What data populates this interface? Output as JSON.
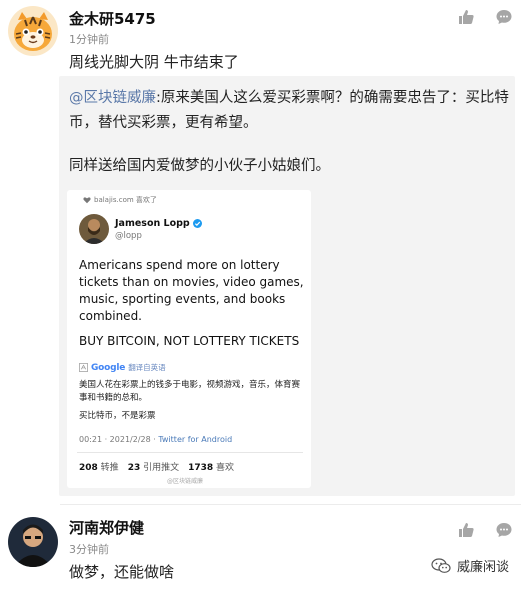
{
  "comments": [
    {
      "username": "金木研5475",
      "time": "1分钟前",
      "text": "周线光脚大阴 牛市结束了",
      "quote": {
        "mention": "@区块链威廉",
        "text": ":原来美国人这么爱买彩票啊？的确需要忠告了：买比特币，替代买彩票，更有希望。",
        "text2": "同样送给国内爱做梦的小伙子小姑娘们。",
        "tweet": {
          "source": "balajis.com 喜欢了",
          "name": "Jameson Lopp",
          "handle": "@lopp",
          "body": "Americans spend more on lottery tickets than on movies, video games, music, sporting events, and books combined.",
          "caps": "BUY BITCOIN, NOT LOTTERY TICKETS",
          "google_label": "Google",
          "translate_label": "翻译自英语",
          "translation1": "美国人花在彩票上的钱多于电影，视频游戏，音乐，体育赛事和书籍的总和。",
          "translation2": "买比特币，不是彩票",
          "time": "00:21 · 2021/2/28 · ",
          "app": "Twitter for Android",
          "retweets": "208",
          "retweets_label": "转推",
          "quotes": "23",
          "quotes_label": "引用推文",
          "likes": "1738",
          "likes_label": "喜欢",
          "watermark": "@区块链威廉"
        }
      }
    },
    {
      "username": "河南郑伊健",
      "time": "3分钟前",
      "text": "做梦，还能做啥"
    }
  ],
  "icons": {
    "like": "thumbs-up-icon",
    "reply": "comment-bubble-icon",
    "verified": "verified-badge-icon",
    "wechat": "wechat-icon"
  },
  "watermark": {
    "label": "威廉闲谈"
  },
  "colors": {
    "mention": "#5a78a8",
    "quote_bg": "#f3f3f3",
    "twitter_blue": "#1d9bf0"
  }
}
